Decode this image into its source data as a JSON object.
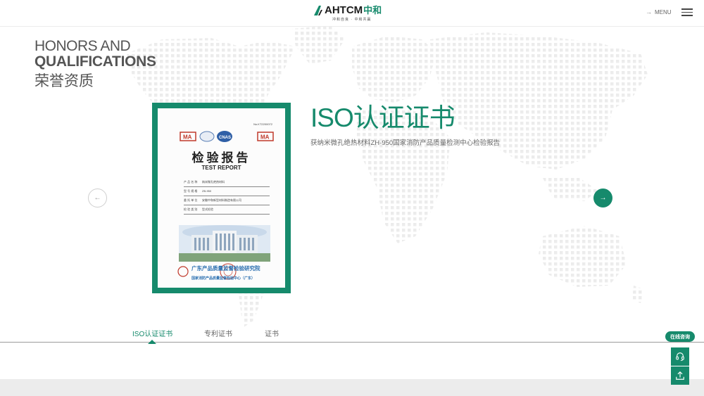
{
  "header": {
    "logo_text": "AHTCM",
    "logo_cn": "中和",
    "logo_slogan": "冲和自良 · 中和共赢",
    "menu_label": "MENU"
  },
  "section": {
    "title_en_line1": "HONORS AND",
    "title_en_line2": "QUALIFICATIONS",
    "title_cn": "荣誉资质"
  },
  "certificate": {
    "heading": "ISO认证证书",
    "description": "获纳米微孔绝热材料ZH-950国家消防产品质量检测中心检验报告",
    "doc": {
      "number": "No.KT2200072",
      "title": "检验报告",
      "subtitle": "TEST REPORT",
      "rows": [
        {
          "key": "产 品 名 称",
          "value": "纳米微孔绝热材料"
        },
        {
          "key": "型 号 规 格",
          "value": "ZB-950"
        },
        {
          "key": "委 托 单 位",
          "value": "安徽中和新型材料制造有限公司"
        },
        {
          "key": "检 验 类 别",
          "value": "型式检验"
        }
      ],
      "org_line1": "广东产品质量监督检验研究院",
      "org_line2": "国家消防产品质量监督检验中心（广东）"
    }
  },
  "tabs": [
    {
      "label": "ISO认证证书",
      "active": true
    },
    {
      "label": "专利证书",
      "active": false
    },
    {
      "label": "证书",
      "active": false
    }
  ],
  "floating": {
    "consult_label": "在线咨询"
  },
  "colors": {
    "accent": "#168a6c",
    "text": "#555555"
  },
  "icons": [
    "arrow-right-icon",
    "hamburger-icon",
    "arrow-left-icon",
    "headset-icon",
    "upload-icon"
  ]
}
